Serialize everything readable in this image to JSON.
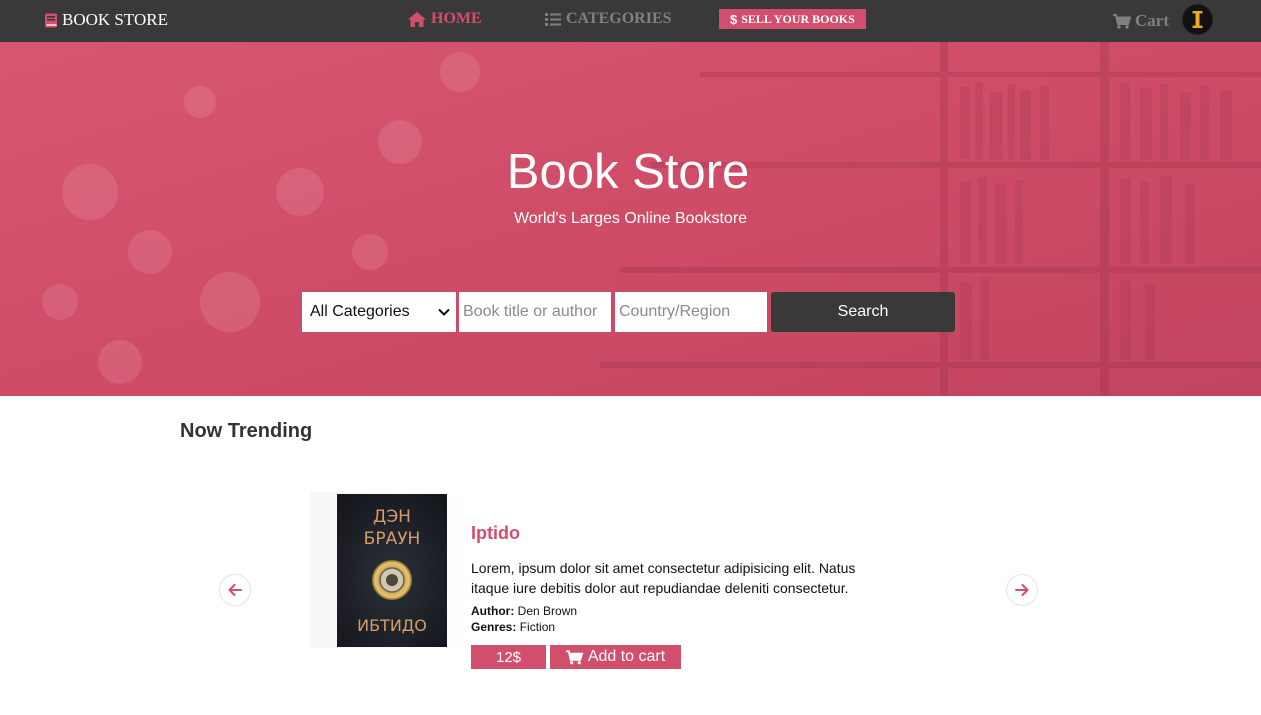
{
  "navbar": {
    "brand": "BOOK STORE",
    "home": "HOME",
    "categories": "CATEGORIES",
    "sell": "SELL YOUR BOOKS",
    "cart": "Cart",
    "avatar_letter": "I"
  },
  "hero": {
    "title": "Book Store",
    "subtitle": "World's Larges Online Bookstore",
    "category_selected": "All Categories",
    "book_placeholder": "Book title or author",
    "country_placeholder": "Country/Region",
    "search_label": "Search"
  },
  "trending": {
    "heading": "Now Trending",
    "book": {
      "title": "Iptido",
      "description": "Lorem, ipsum dolor sit amet consectetur adipisicing elit. Natus itaque iure debitis dolor aut repudiandae deleniti consectetur.",
      "author_label": "Author:",
      "author": "Den Brown",
      "genres_label": "Genres:",
      "genres": "Fiction",
      "price": "12$",
      "add_to_cart": "Add to cart",
      "cover_line1": "ДЭН",
      "cover_line2": "БРАУН",
      "cover_line3": "ИБТИДО"
    }
  },
  "icons": {
    "brand": "book-icon",
    "home": "home-icon",
    "categories": "list-icon",
    "sell": "dollar-icon",
    "cart": "cart-icon",
    "prev": "arrow-left-icon",
    "next": "arrow-right-icon",
    "select": "chevron-down-icon"
  },
  "colors": {
    "accent": "#d14f6d",
    "nav_bg": "#393939",
    "muted": "#808080"
  }
}
